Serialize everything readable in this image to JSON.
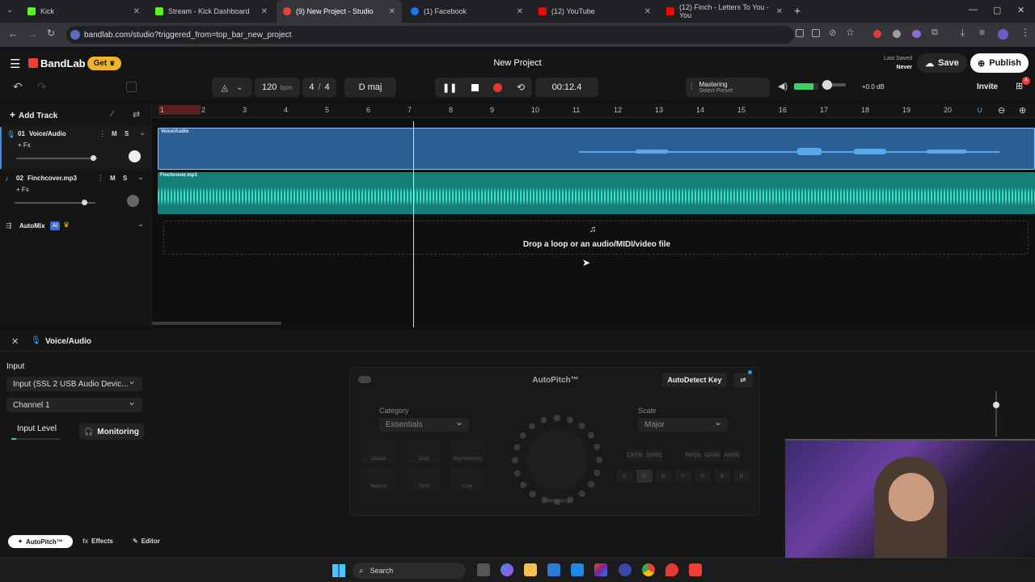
{
  "browser": {
    "tabs": [
      {
        "title": "Kick",
        "color": "#53fc18",
        "left": 0
      },
      {
        "title": "Stream - Kick Dashboard",
        "color": "#53fc18",
        "left": 0
      },
      {
        "title": "(9) New Project - Studio",
        "color": "#f23c36",
        "left": 0
      },
      {
        "title": "(1) Facebook",
        "color": "#1877f2",
        "left": 0
      },
      {
        "title": "(12) YouTube",
        "color": "#ff0000",
        "left": 0
      },
      {
        "title": "(12) Finch - Letters To You - You",
        "color": "#ff0000",
        "left": 0
      }
    ],
    "url": "bandlab.com/studio?triggered_from=top_bar_new_project"
  },
  "app": {
    "logo": "BandLab",
    "get_label": "Get",
    "project_title": "New Project",
    "last_saved_label": "Last Saved",
    "last_saved_value": "Never",
    "save_label": "Save",
    "publish_label": "Publish",
    "invite_label": "Invite",
    "badge_count": "4"
  },
  "toolbar": {
    "bpm": "120",
    "bpm_unit": "bpm",
    "time_sig_top": "4",
    "time_sig_sep": "/",
    "time_sig_bottom": "4",
    "key": "D maj",
    "time": "00:12.4",
    "mastering_label": "Mastering",
    "mastering_preset": "Select Preset",
    "volume_db": "+0.0 dB"
  },
  "tracks": {
    "add_label": "Add Track",
    "items": [
      {
        "number": "01",
        "name": "Voice/Audio",
        "fx": "+ Fx",
        "m": "M",
        "s": "S",
        "region": "Voice/Audio"
      },
      {
        "number": "02",
        "name": "Finchcover.mp3",
        "fx": "+ Fx",
        "m": "M",
        "s": "S",
        "region": "Finchcover.mp3"
      }
    ],
    "automix_label": "AutoMix",
    "ai_badge": "AI"
  },
  "ruler": [
    "1",
    "2",
    "3",
    "4",
    "5",
    "6",
    "7",
    "8",
    "9",
    "10",
    "11",
    "12",
    "13",
    "14",
    "15",
    "16",
    "17",
    "18",
    "19",
    "20"
  ],
  "dropzone": "Drop a loop or an audio/MIDI/video file",
  "bottom": {
    "track_title": "Voice/Audio",
    "input_label": "Input",
    "input_device": "Input (SSL 2 USB Audio Devic...",
    "channel": "Channel 1",
    "input_level_label": "Input Level",
    "monitoring_label": "Monitoring",
    "autopitch_title": "AutoPitch™",
    "autodetect_label": "AutoDetect Key",
    "category_label": "Category",
    "category_value": "Essentials",
    "scale_label": "Scale",
    "scale_value": "Major",
    "knob_label": "Heaviest",
    "effect_buttons": [
      "Classic",
      "Duet",
      "Big Harmony",
      "Natural",
      "Third",
      "Chip"
    ],
    "key_buttons_top": [
      "C#/Db",
      "D#/Eb",
      "F#/Gb",
      "G#/Ab",
      "A#/Bb"
    ],
    "key_buttons_bottom": [
      "C",
      "D",
      "E",
      "F",
      "G",
      "A",
      "B"
    ],
    "tabs": [
      "AutoPitch™",
      "Effects",
      "Editor"
    ]
  },
  "taskbar": {
    "search_label": "Search"
  }
}
